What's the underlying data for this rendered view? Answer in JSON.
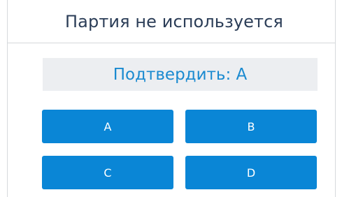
{
  "header": {
    "title": "Партия не используется"
  },
  "confirm": {
    "label": "Подтвердить: A"
  },
  "choices": [
    {
      "label": "A"
    },
    {
      "label": "B"
    },
    {
      "label": "C"
    },
    {
      "label": "D"
    }
  ],
  "colors": {
    "title_text": "#2b3d57",
    "confirm_bg": "#eceef1",
    "confirm_text": "#1a8ad0",
    "button_bg": "#0a86d6",
    "button_text": "#ffffff"
  }
}
